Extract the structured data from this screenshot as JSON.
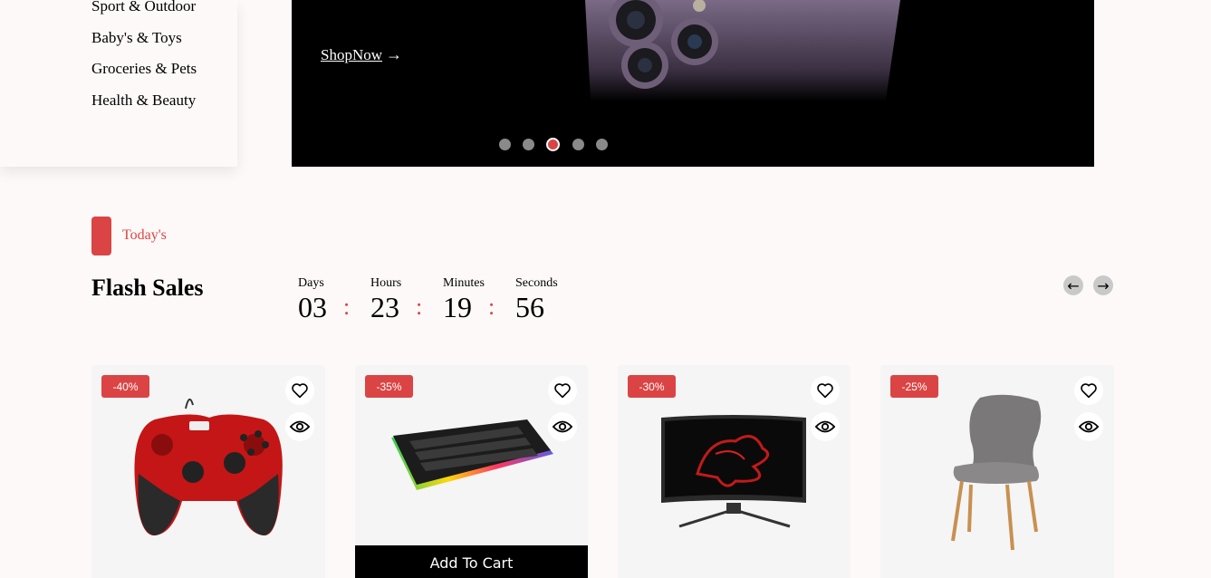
{
  "sidebar": {
    "items": [
      {
        "label": "Sport & Outdoor"
      },
      {
        "label": "Baby's & Toys"
      },
      {
        "label": "Groceries & Pets"
      },
      {
        "label": "Health & Beauty"
      }
    ]
  },
  "hero": {
    "cta_label": "ShopNow",
    "cta_arrow": "→",
    "active_slide": 3,
    "slide_count": 5
  },
  "section": {
    "tag": "Today's",
    "title": "Flash Sales"
  },
  "countdown": [
    {
      "label": "Days",
      "value": "03"
    },
    {
      "label": "Hours",
      "value": "23"
    },
    {
      "label": "Minutes",
      "value": "19"
    },
    {
      "label": "Seconds",
      "value": "56"
    }
  ],
  "countdown_separator": ":",
  "nav": {
    "prev": "←",
    "next": "→"
  },
  "colors": {
    "accent": "#db4444",
    "card_bg": "#f5f5f5",
    "page_bg": "#fdf9f8"
  },
  "products": [
    {
      "discount": "-40%",
      "image": "gamepad",
      "icons": [
        "heart-icon",
        "eye-icon"
      ]
    },
    {
      "discount": "-35%",
      "image": "keyboard",
      "icons": [
        "heart-icon",
        "eye-icon"
      ],
      "cart_label": "Add To Cart"
    },
    {
      "discount": "-30%",
      "image": "monitor",
      "icons": [
        "heart-icon",
        "eye-icon"
      ]
    },
    {
      "discount": "-25%",
      "image": "chair",
      "icons": [
        "heart-icon",
        "eye-icon"
      ]
    }
  ]
}
